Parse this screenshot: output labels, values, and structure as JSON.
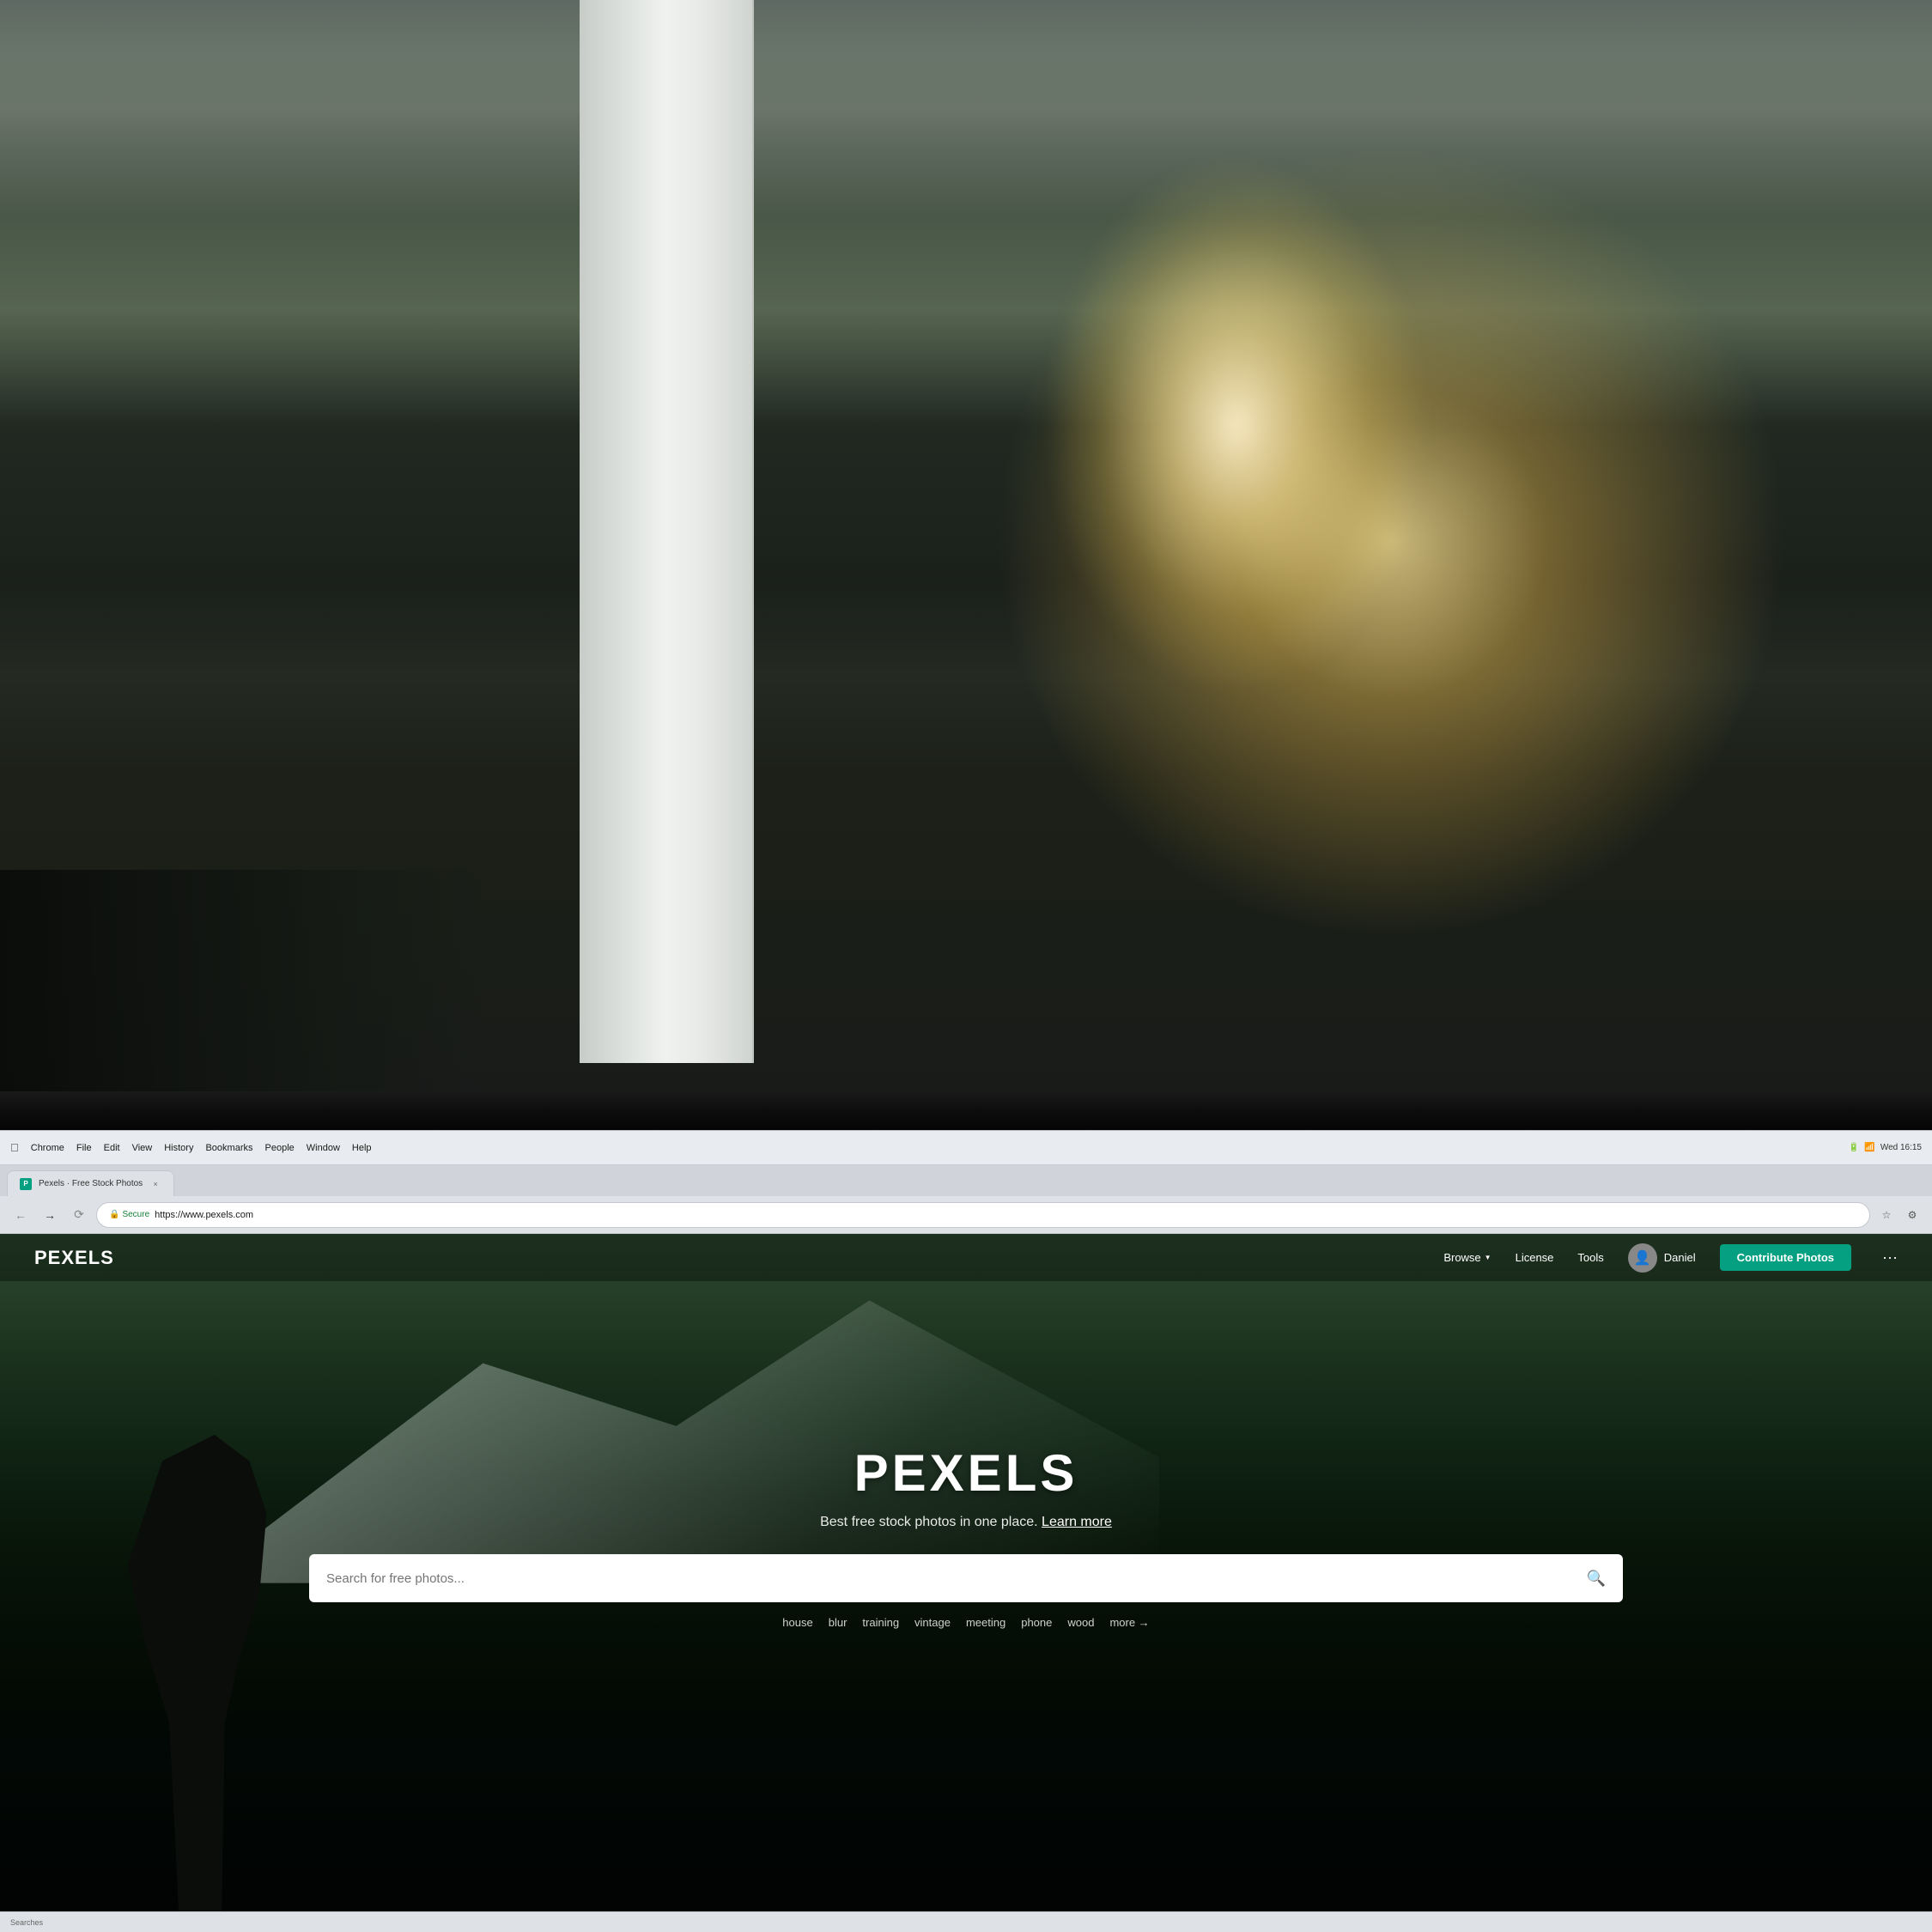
{
  "background": {
    "office_description": "blurred office interior with white column, windows, plants, warm light"
  },
  "mac_menubar": {
    "chrome_app": "Chrome",
    "menu_items": [
      "File",
      "Edit",
      "View",
      "History",
      "Bookmarks",
      "People",
      "Window",
      "Help"
    ],
    "time": "Wed 16:15",
    "battery": "100 %"
  },
  "browser": {
    "tab": {
      "favicon_text": "P",
      "title": "Pexels · Free Stock Photos",
      "close_label": "×"
    },
    "address": {
      "secure_label": "Secure",
      "url": "https://www.pexels.com"
    }
  },
  "pexels": {
    "site_title": "PEXELS",
    "nav": {
      "browse_label": "Browse",
      "license_label": "License",
      "tools_label": "Tools",
      "user_name": "Daniel",
      "contribute_label": "Contribute Photos",
      "more_label": "···"
    },
    "hero": {
      "title": "PEXELS",
      "subtitle": "Best free stock photos in one place.",
      "learn_more_label": "Learn more",
      "search_placeholder": "Search for free photos...",
      "tags": [
        "house",
        "blur",
        "training",
        "vintage",
        "meeting",
        "phone",
        "wood",
        "more →"
      ]
    }
  },
  "status_bar": {
    "text": "Searches"
  }
}
